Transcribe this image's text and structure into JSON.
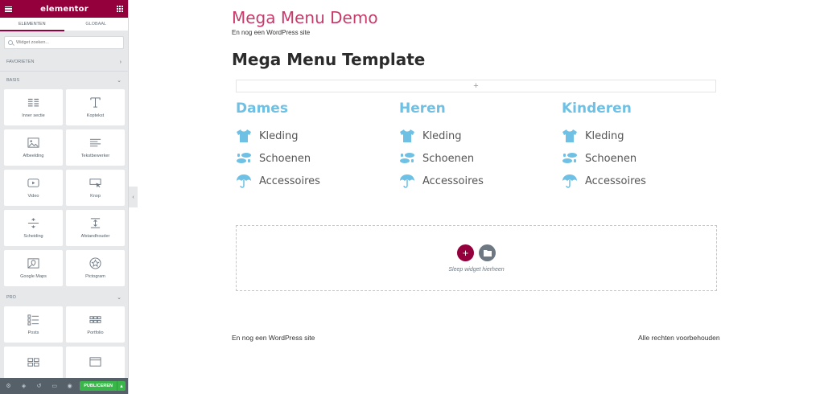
{
  "sidebar": {
    "brand": "elementor",
    "tabs": [
      "ELEMENTEN",
      "GLOBAAL"
    ],
    "search_placeholder": "Widget zoeken...",
    "sections": {
      "favorites": "FAVORIETEN",
      "basic": "BASIS",
      "pro": "PRO"
    },
    "basic_widgets": [
      {
        "label": "Inner sectie",
        "icon": "inner-section-icon"
      },
      {
        "label": "Koptekst",
        "icon": "heading-icon"
      },
      {
        "label": "Afbeelding",
        "icon": "image-icon"
      },
      {
        "label": "Tekstbewerker",
        "icon": "text-editor-icon"
      },
      {
        "label": "Video",
        "icon": "video-icon"
      },
      {
        "label": "Knop",
        "icon": "button-icon"
      },
      {
        "label": "Scheiding",
        "icon": "divider-icon"
      },
      {
        "label": "Afstandhouder",
        "icon": "spacer-icon"
      },
      {
        "label": "Google Maps",
        "icon": "map-icon"
      },
      {
        "label": "Pictogram",
        "icon": "star-icon"
      }
    ],
    "pro_widgets": [
      {
        "label": "Posts",
        "icon": "posts-icon"
      },
      {
        "label": "Portfolio",
        "icon": "portfolio-icon"
      }
    ],
    "footer": {
      "publish_label": "PUBLICEREN",
      "publish_arrow": "▴",
      "icons": [
        "settings-icon",
        "layers-icon",
        "history-icon",
        "responsive-icon",
        "preview-icon"
      ]
    }
  },
  "page": {
    "site_title": "Mega Menu Demo",
    "tagline": "En nog een WordPress site",
    "page_title": "Mega Menu Template",
    "add_row_symbol": "+",
    "menu_columns": [
      {
        "heading": "Dames",
        "items": [
          {
            "label": "Kleding",
            "icon": "tshirt-icon"
          },
          {
            "label": "Schoenen",
            "icon": "shoe-prints-icon"
          },
          {
            "label": "Accessoires",
            "icon": "umbrella-icon"
          }
        ]
      },
      {
        "heading": "Heren",
        "items": [
          {
            "label": "Kleding",
            "icon": "tshirt-icon"
          },
          {
            "label": "Schoenen",
            "icon": "shoe-prints-icon"
          },
          {
            "label": "Accessoires",
            "icon": "umbrella-icon"
          }
        ]
      },
      {
        "heading": "Kinderen",
        "items": [
          {
            "label": "Kleding",
            "icon": "tshirt-icon"
          },
          {
            "label": "Schoenen",
            "icon": "shoe-prints-icon"
          },
          {
            "label": "Accessoires",
            "icon": "umbrella-icon"
          }
        ]
      }
    ],
    "dropzone_text": "Sleep widget hierheen",
    "dropzone_add_symbol": "+",
    "footer_left": "En nog een WordPress site",
    "footer_right": "Alle rechten voorbehouden"
  },
  "colors": {
    "brand": "#93003c",
    "site_title": "#c63b6b",
    "menu_accent": "#6ec1e4",
    "publish": "#39b54a"
  }
}
